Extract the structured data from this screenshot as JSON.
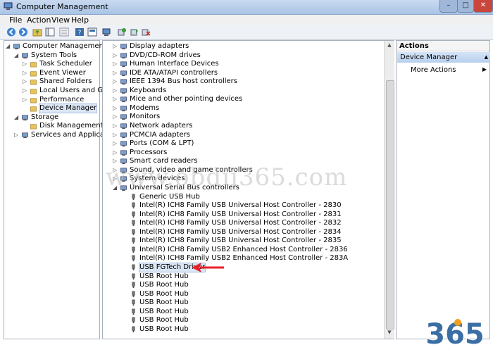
{
  "window": {
    "title": "Computer Management",
    "controls": [
      "–",
      "□",
      "✕"
    ]
  },
  "menu": [
    "File",
    "Action",
    "View",
    "Help"
  ],
  "left_tree": [
    {
      "label": "Computer Management (Local",
      "indent": 0,
      "twisty": "open"
    },
    {
      "label": "System Tools",
      "indent": 1,
      "twisty": "open"
    },
    {
      "label": "Task Scheduler",
      "indent": 2,
      "twisty": "closed"
    },
    {
      "label": "Event Viewer",
      "indent": 2,
      "twisty": "closed"
    },
    {
      "label": "Shared Folders",
      "indent": 2,
      "twisty": "closed"
    },
    {
      "label": "Local Users and Groups",
      "indent": 2,
      "twisty": "closed"
    },
    {
      "label": "Performance",
      "indent": 2,
      "twisty": "closed"
    },
    {
      "label": "Device Manager",
      "indent": 2,
      "twisty": "none",
      "selected": true
    },
    {
      "label": "Storage",
      "indent": 1,
      "twisty": "open"
    },
    {
      "label": "Disk Management",
      "indent": 2,
      "twisty": "none"
    },
    {
      "label": "Services and Applications",
      "indent": 1,
      "twisty": "closed"
    }
  ],
  "device_tree": [
    {
      "label": "Display adapters",
      "indent": 0,
      "twisty": "closed"
    },
    {
      "label": "DVD/CD-ROM drives",
      "indent": 0,
      "twisty": "closed"
    },
    {
      "label": "Human Interface Devices",
      "indent": 0,
      "twisty": "closed"
    },
    {
      "label": "IDE ATA/ATAPI controllers",
      "indent": 0,
      "twisty": "closed"
    },
    {
      "label": "IEEE 1394 Bus host controllers",
      "indent": 0,
      "twisty": "closed"
    },
    {
      "label": "Keyboards",
      "indent": 0,
      "twisty": "closed"
    },
    {
      "label": "Mice and other pointing devices",
      "indent": 0,
      "twisty": "closed"
    },
    {
      "label": "Modems",
      "indent": 0,
      "twisty": "closed"
    },
    {
      "label": "Monitors",
      "indent": 0,
      "twisty": "closed"
    },
    {
      "label": "Network adapters",
      "indent": 0,
      "twisty": "closed"
    },
    {
      "label": "PCMCIA adapters",
      "indent": 0,
      "twisty": "closed"
    },
    {
      "label": "Ports (COM & LPT)",
      "indent": 0,
      "twisty": "closed"
    },
    {
      "label": "Processors",
      "indent": 0,
      "twisty": "closed"
    },
    {
      "label": "Smart card readers",
      "indent": 0,
      "twisty": "closed"
    },
    {
      "label": "Sound, video and game controllers",
      "indent": 0,
      "twisty": "closed"
    },
    {
      "label": "System devices",
      "indent": 0,
      "twisty": "closed"
    },
    {
      "label": "Universal Serial Bus controllers",
      "indent": 0,
      "twisty": "open"
    },
    {
      "label": "Generic USB Hub",
      "indent": 1,
      "twisty": "none"
    },
    {
      "label": "Intel(R) ICH8 Family USB Universal Host Controller - 2830",
      "indent": 1,
      "twisty": "none"
    },
    {
      "label": "Intel(R) ICH8 Family USB Universal Host Controller - 2831",
      "indent": 1,
      "twisty": "none"
    },
    {
      "label": "Intel(R) ICH8 Family USB Universal Host Controller - 2832",
      "indent": 1,
      "twisty": "none"
    },
    {
      "label": "Intel(R) ICH8 Family USB Universal Host Controller - 2834",
      "indent": 1,
      "twisty": "none"
    },
    {
      "label": "Intel(R) ICH8 Family USB Universal Host Controller - 2835",
      "indent": 1,
      "twisty": "none"
    },
    {
      "label": "Intel(R) ICH8 Family USB2 Enhanced Host Controller - 2836",
      "indent": 1,
      "twisty": "none"
    },
    {
      "label": "Intel(R) ICH8 Family USB2 Enhanced Host Controller - 283A",
      "indent": 1,
      "twisty": "none"
    },
    {
      "label": "USB FGTech Driver",
      "indent": 1,
      "twisty": "none",
      "selected": true
    },
    {
      "label": "USB Root Hub",
      "indent": 1,
      "twisty": "none"
    },
    {
      "label": "USB Root Hub",
      "indent": 1,
      "twisty": "none"
    },
    {
      "label": "USB Root Hub",
      "indent": 1,
      "twisty": "none"
    },
    {
      "label": "USB Root Hub",
      "indent": 1,
      "twisty": "none"
    },
    {
      "label": "USB Root Hub",
      "indent": 1,
      "twisty": "none"
    },
    {
      "label": "USB Root Hub",
      "indent": 1,
      "twisty": "none"
    },
    {
      "label": "USB Root Hub",
      "indent": 1,
      "twisty": "none"
    }
  ],
  "actions": {
    "header": "Actions",
    "section": "Device Manager",
    "items": [
      {
        "label": "More Actions",
        "arrow": "▶"
      }
    ],
    "section_arrow": "▲"
  },
  "watermark": "www.obdii365.com",
  "logo": "365",
  "colors": {
    "accent": "#3a6ea5",
    "arrow": "#e8202a",
    "logo_orange": "#f0a020"
  }
}
